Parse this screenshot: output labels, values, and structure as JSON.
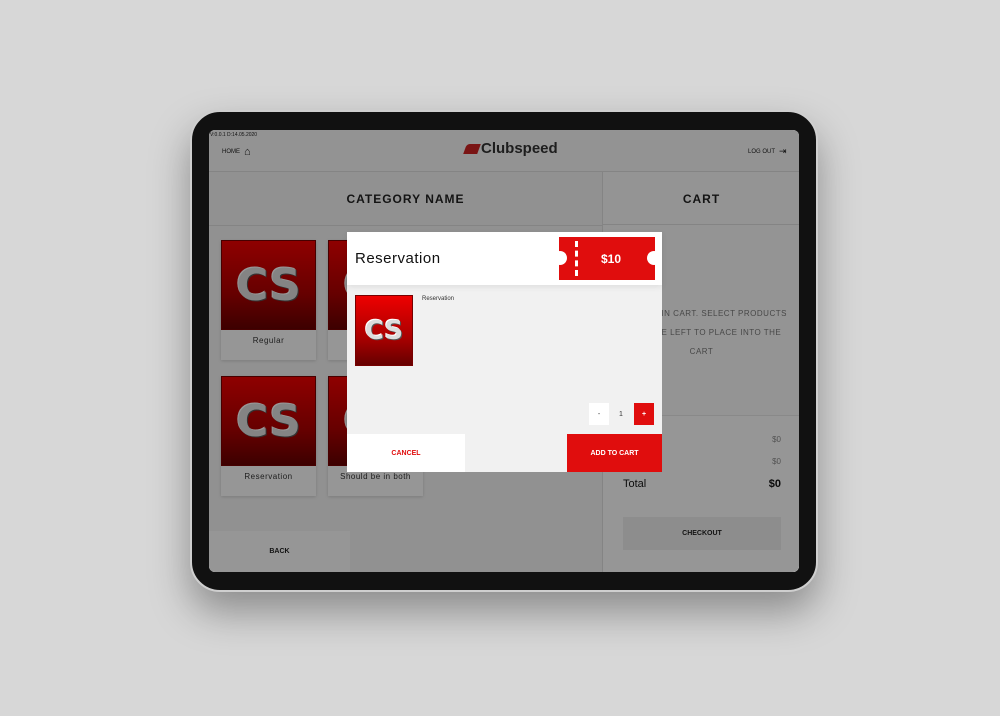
{
  "version": "V:0.0.1 D:14.05.2020",
  "header": {
    "home": "HOME",
    "logo": "Clubspeed",
    "logout": "LOG OUT"
  },
  "category": {
    "title": "CATEGORY NAME",
    "items": [
      {
        "label": "Regular"
      },
      {
        "label": ""
      },
      {
        "label": "Reservation"
      },
      {
        "label": "Should be in both"
      }
    ],
    "back": "BACK",
    "image_text": "CS"
  },
  "cart": {
    "title": "CART",
    "empty": "NO ITEMS IN CART. SELECT PRODUCTS FROM THE LEFT TO PLACE INTO THE CART",
    "rows": [
      {
        "label": "",
        "value": "$0"
      },
      {
        "label": "",
        "value": "$0"
      }
    ],
    "total_label": "Total",
    "total_value": "$0",
    "checkout": "CHECKOUT"
  },
  "modal": {
    "title": "Reservation",
    "price": "$10",
    "description": "Reservation",
    "image_text": "CS",
    "qty_minus": "-",
    "qty": "1",
    "qty_plus": "+",
    "cancel": "CANCEL",
    "add": "ADD TO CART"
  },
  "colors": {
    "accent": "#e00d0d"
  }
}
